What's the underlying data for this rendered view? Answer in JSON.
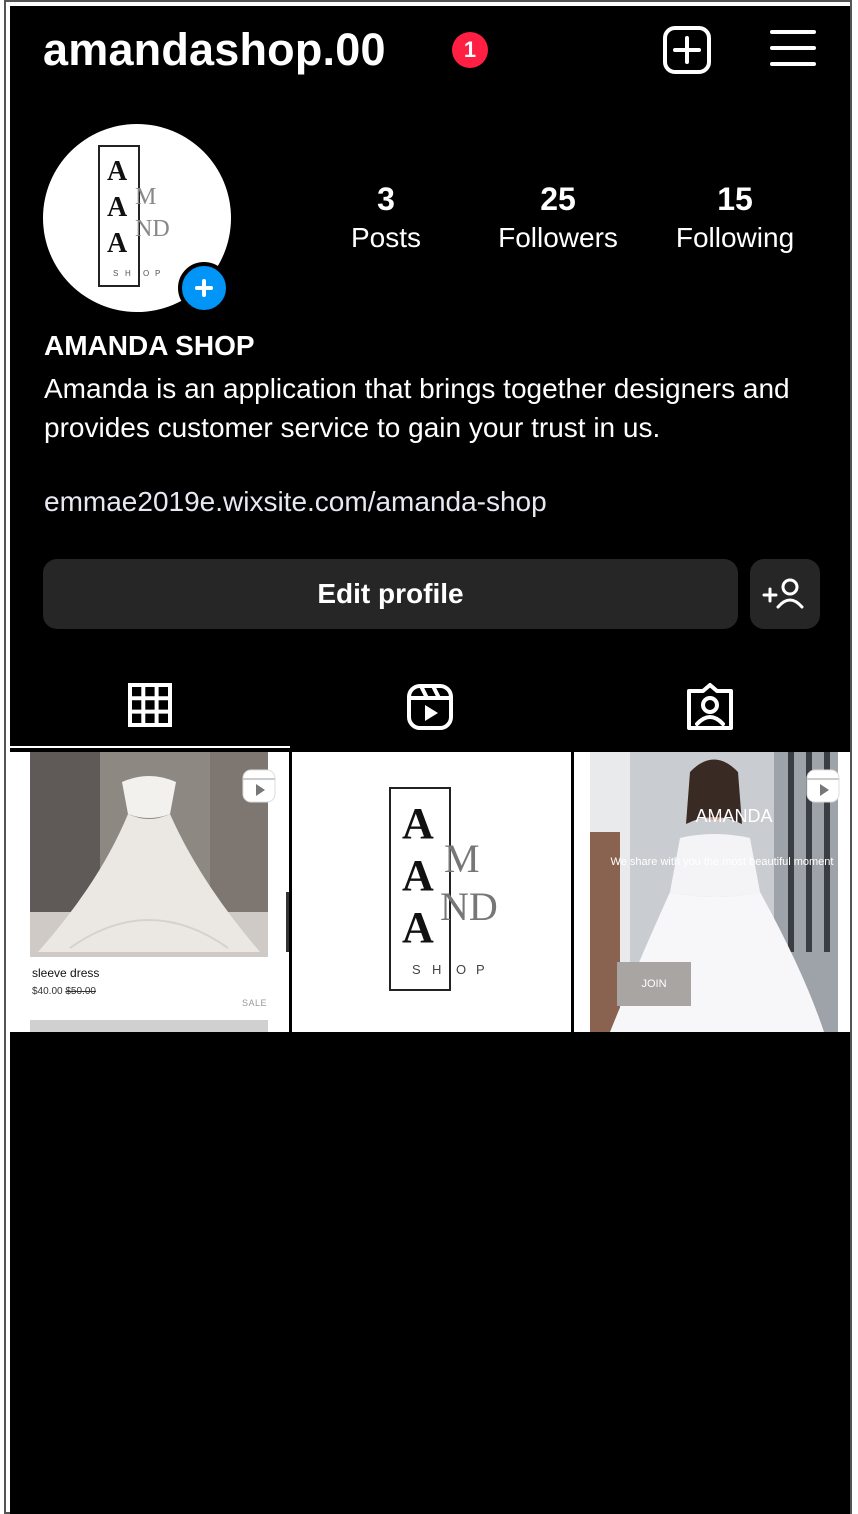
{
  "header": {
    "username": "amandashop.00",
    "notification_count": "1"
  },
  "profile": {
    "stats": [
      {
        "value": "3",
        "label": "Posts"
      },
      {
        "value": "25",
        "label": "Followers"
      },
      {
        "value": "15",
        "label": "Following"
      }
    ],
    "display_name": "AMANDA SHOP",
    "bio": "Amanda is an application that brings together designers and provides customer service to gain your trust in us.",
    "link": "emmae2019e.wixsite.com/amanda-shop"
  },
  "actions": {
    "edit_label": "Edit profile"
  },
  "logo": {
    "a1": "A",
    "m": "M",
    "a2": "A",
    "nd": "ND",
    "a3": "A",
    "shop": [
      "S",
      "H",
      "O",
      "P"
    ]
  },
  "posts": {
    "dress_caption": "sleeve dress",
    "dress_price": "$40.00",
    "dress_old_price": "$50.00",
    "dress_sale": "SALE",
    "amanda_title": "AMANDA",
    "amanda_subtitle": "We share with you the most beautiful moment",
    "join_label": "JOIN"
  },
  "colors": {
    "background": "#000000",
    "button": "#262626",
    "notification": "#ff1f42",
    "accent_blue": "#0095f6"
  },
  "icons": [
    "plus-square-icon",
    "menu-icon",
    "add-person-icon",
    "grid-icon",
    "reels-icon",
    "tagged-icon"
  ]
}
